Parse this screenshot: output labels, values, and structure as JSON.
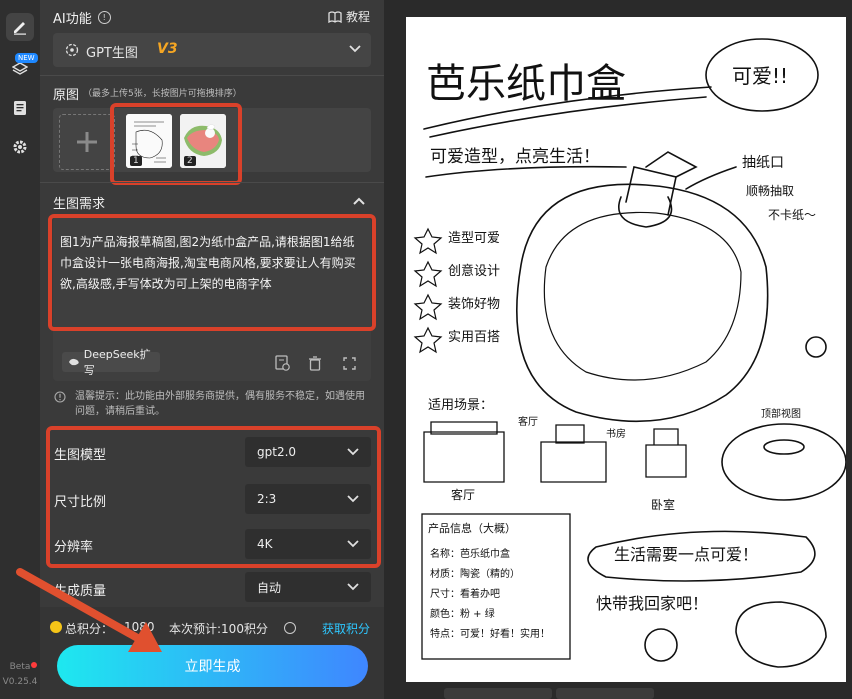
{
  "sidebar": {
    "new_badge": "NEW",
    "beta": "Beta",
    "version": "V0.25.4",
    "icons": [
      "edit-icon",
      "layers-icon",
      "document-icon",
      "gear-icon"
    ]
  },
  "header": {
    "title": "AI功能",
    "info_glyph": "!",
    "tutorial_label": "教程"
  },
  "model_selector": {
    "name": "GPT生图",
    "version": "V3"
  },
  "source_images": {
    "title": "原图",
    "hint": "（最多上传5张，长按图片可拖拽排序）",
    "items": [
      {
        "index": "1"
      },
      {
        "index": "2"
      }
    ]
  },
  "prompt": {
    "title": "生图需求",
    "text": "图1为产品海报草稿图,图2为纸巾盒产品,请根据图1给纸巾盒设计一张电商海报,淘宝电商风格,要求要让人有购买欲,高级感,手写体改为可上架的电商字体",
    "deepseek_label": "DeepSeek扩写"
  },
  "notice": {
    "text": "温馨提示：此功能由外部服务商提供，偶有服务不稳定，如遇使用问题，请稍后重试。"
  },
  "settings": {
    "model": {
      "label": "生图模型",
      "value": "gpt2.0"
    },
    "ratio": {
      "label": "尺寸比例",
      "value": "2:3"
    },
    "resolution": {
      "label": "分辨率",
      "value": "4K"
    },
    "quality": {
      "label": "生成质量",
      "value": "自动"
    }
  },
  "points": {
    "total_label": "总积分：",
    "total_value": "1080",
    "estimate_label": "本次预计:100积分",
    "get_points": "获取积分"
  },
  "generate_button": "立即生成",
  "poster": {
    "title": "芭乐纸巾盒",
    "badge": "可爱!!",
    "slogan": "可爱造型，点亮生活！",
    "callout_title": "抽纸口",
    "callout_line1": "顺畅抽取",
    "callout_line2": "不卡纸～",
    "features": [
      "造型可爱",
      "创意设计",
      "装饰好物",
      "实用百搭"
    ],
    "scene_title": "适用场景：",
    "scenes": [
      "客厅",
      "客厅",
      "书房",
      "卧室"
    ],
    "top_view": "顶部视图",
    "info_title": "产品信息（大概）",
    "info_lines": [
      "名称：芭乐纸巾盒",
      "材质：陶瓷（精的）",
      "尺寸：看着办吧",
      "颜色：粉 + 绿",
      "特点：可爱！好看！实用！"
    ],
    "bubble": "生活需要一点可爱！",
    "cta": "快带我回家吧！"
  },
  "colors": {
    "accent_red": "#d9412a",
    "v3_gold": "#f5a623",
    "link_blue": "#2ec7ff",
    "coin": "#f5c518"
  }
}
